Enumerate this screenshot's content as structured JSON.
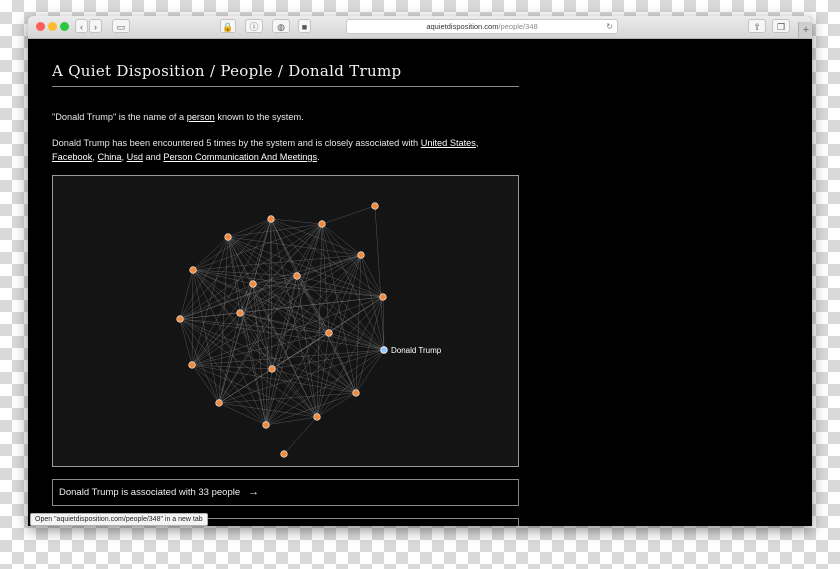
{
  "browser": {
    "url_domain": "aquietdisposition.com",
    "url_path": "/people/348",
    "status_bar": "Open \"aquietdisposition.com/people/348\" in a new tab",
    "toolbar_glyphs": {
      "back": "‹",
      "forward": "›",
      "sidebar": "▭",
      "lock": "🔒",
      "info": "ⓘ",
      "reader": "◍",
      "stop": "■",
      "reload": "↻",
      "share": "⇧",
      "tabs": "❐",
      "new_tab": "+"
    }
  },
  "page": {
    "title": "A Quiet Disposition / People / Donald Trump",
    "intro": {
      "before": "\"Donald Trump\" is the name of a ",
      "link": "person",
      "after": " known to the system."
    },
    "associations": {
      "before": "Donald Trump has been encountered 5 times by the system and is closely associated with ",
      "links": [
        "United States",
        "Facebook",
        "China",
        "Usd",
        "Person Communication And Meetings"
      ],
      "sep1": ", ",
      "sep2": ", ",
      "sep3": ", ",
      "and": " and ",
      "end": "."
    },
    "association_count_text": "Donald Trump is associated with 33 people",
    "arrow": "→"
  },
  "graph": {
    "focus_label": "Donald Trump",
    "node_color": "#f08a3c",
    "focus_color": "#8cc8ff",
    "edge_color": "#8a8a8a"
  }
}
